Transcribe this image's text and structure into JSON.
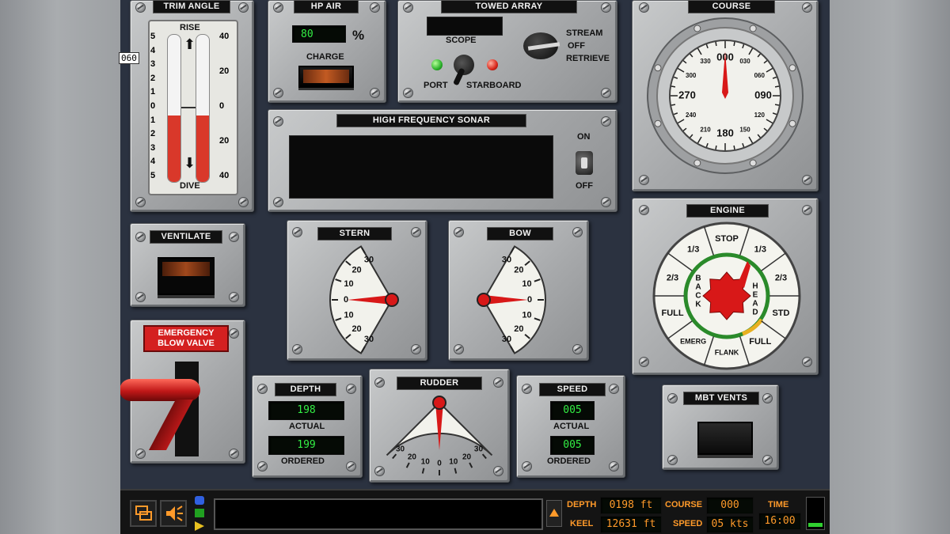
{
  "left_marker": "060",
  "trim": {
    "title": "TRIM ANGLE",
    "rise": "RISE",
    "dive": "DIVE",
    "left_scale": [
      "5",
      "4",
      "3",
      "2",
      "1",
      "0",
      "1",
      "2",
      "3",
      "4",
      "5"
    ],
    "right_scale": [
      "40",
      "20",
      "0",
      "20",
      "40"
    ],
    "level_fraction": 0.45
  },
  "hp_air": {
    "title": "HP AIR",
    "value": "80",
    "unit": "%",
    "charge_label": "CHARGE"
  },
  "towed_array": {
    "title": "TOWED ARRAY",
    "scope": "SCOPE",
    "port": "PORT",
    "starboard": "STARBOARD",
    "stream": "STREAM",
    "off": "OFF",
    "retrieve": "RETRIEVE"
  },
  "sonar": {
    "title": "HIGH FREQUENCY SONAR",
    "on": "ON",
    "off": "OFF"
  },
  "course": {
    "title": "COURSE",
    "major": [
      "000",
      "090",
      "180",
      "270"
    ],
    "minor": [
      "030",
      "060",
      "120",
      "150",
      "210",
      "240",
      "300",
      "330"
    ]
  },
  "ventilate": {
    "title": "VENTILATE"
  },
  "emergency": {
    "label": "EMERGENCY BLOW VALVE"
  },
  "stern": {
    "title": "STERN",
    "ticks": [
      "30",
      "20",
      "10",
      "0",
      "10",
      "20",
      "30"
    ]
  },
  "bow": {
    "title": "BOW",
    "ticks": [
      "30",
      "20",
      "10",
      "0",
      "10",
      "20",
      "30"
    ]
  },
  "engine": {
    "title": "ENGINE",
    "ahead_word": "HEAD",
    "back_word": "BACK",
    "positions": [
      "STOP",
      "1/3",
      "2/3",
      "STD",
      "FULL",
      "FLANK",
      "EMERG",
      "FULL",
      "2/3",
      "1/3"
    ]
  },
  "depth": {
    "title": "DEPTH",
    "actual_value": "198",
    "actual_label": "ACTUAL",
    "ordered_value": "199",
    "ordered_label": "ORDERED"
  },
  "rudder": {
    "title": "RUDDER",
    "ticks": [
      "30",
      "20",
      "10",
      "0",
      "10",
      "20",
      "30"
    ]
  },
  "speed": {
    "title": "SPEED",
    "actual_value": "005",
    "actual_label": "ACTUAL",
    "ordered_value": "005",
    "ordered_label": "ORDERED"
  },
  "mbt_vents": {
    "title": "MBT VENTS"
  },
  "status": {
    "depth_label": "DEPTH",
    "depth_value": "0198 ft",
    "keel_label": "KEEL",
    "keel_value": "12631 ft",
    "course_label": "COURSE",
    "course_value": "000",
    "speed_label": "SPEED",
    "speed_value": "05 kts",
    "time_label": "TIME",
    "time_value": "16:00"
  },
  "colors": {
    "accent": "#ff9a2a",
    "lcd": "#33ee44",
    "needle": "#d81818"
  }
}
